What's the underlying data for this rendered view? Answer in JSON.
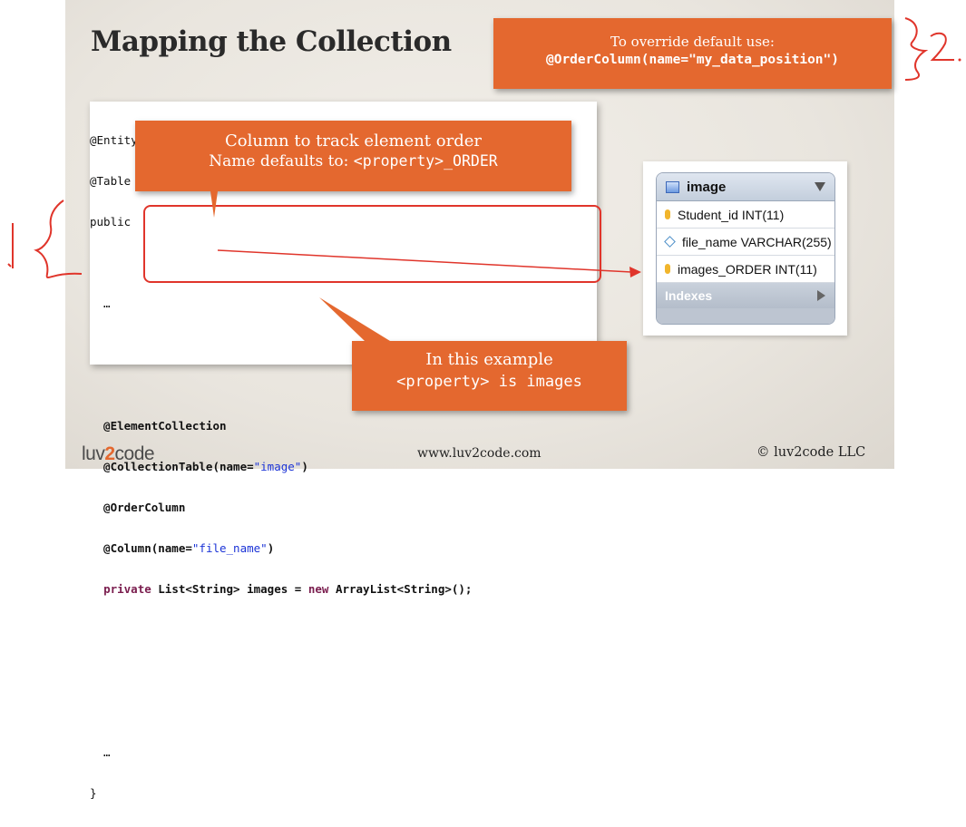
{
  "slide": {
    "title": "Mapping the Collection",
    "override_callout": {
      "line1": "To override default use:",
      "line2": "@OrderColumn(name=\"my_data_position\")"
    },
    "order_callout": {
      "line1": "Column to track element order",
      "line2_prefix": "Name defaults to: ",
      "line2_code": "<property>_ORDER"
    },
    "example_callout": {
      "line1": "In this example",
      "line2": "<property> is images"
    },
    "code": {
      "l1": "@Entity",
      "l2": "@Table",
      "l3": "public",
      "l4": "  …",
      "l5": "  @ElementCollection",
      "l6a": "  @CollectionTable(name=",
      "l6s": "\"image\"",
      "l6b": ")",
      "l7": "  @OrderColumn",
      "l8a": "  @Column(name=",
      "l8s": "\"file_name\"",
      "l8b": ")",
      "l9a": "  ",
      "l9k1": "private",
      "l9b": " List<String> images = ",
      "l9k2": "new",
      "l9c": " ArrayList<String>();",
      "l10": "  …",
      "l11": "}"
    },
    "db_table": {
      "name": "image",
      "columns": [
        "Student_id INT(11)",
        "file_name VARCHAR(255)",
        "images_ORDER INT(11)"
      ],
      "indexes_label": "Indexes"
    },
    "footer": {
      "logo_pre": "luv",
      "logo_two": "2",
      "logo_post": "code",
      "url": "www.luv2code.com",
      "copyright": "© luv2code LLC"
    }
  },
  "colors": {
    "callout": "#e4682f",
    "annotation": "#e0352b",
    "string": "#1b33d6"
  }
}
